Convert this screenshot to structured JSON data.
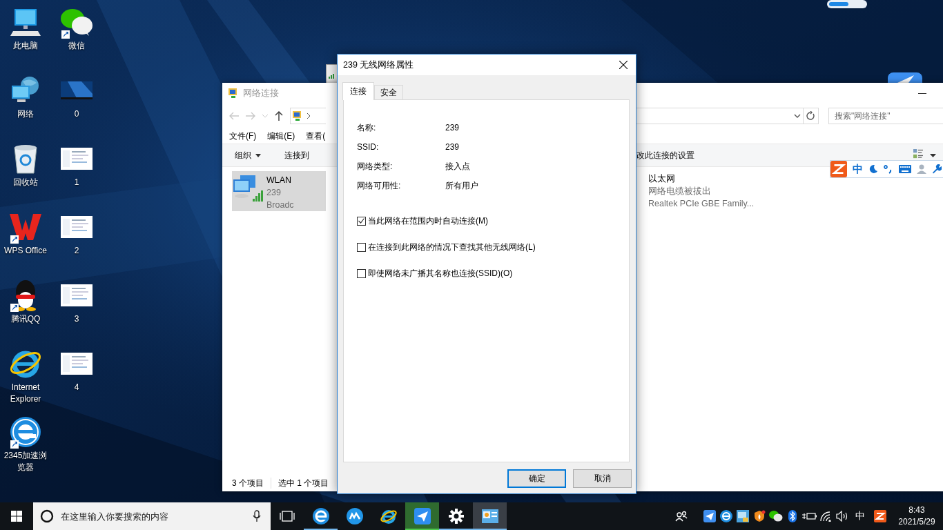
{
  "desktop": {
    "icons": [
      {
        "label": "此电脑",
        "kind": "computer",
        "shortcut": false
      },
      {
        "label": "微信",
        "kind": "wechat",
        "shortcut": true
      },
      {
        "label": "网络",
        "kind": "network",
        "shortcut": false
      },
      {
        "label": "0",
        "kind": "wallpaper-thumb",
        "shortcut": false
      },
      {
        "label": "回收站",
        "kind": "recycle-bin",
        "shortcut": false
      },
      {
        "label": "1",
        "kind": "page-thumb",
        "shortcut": false
      },
      {
        "label": "WPS Office",
        "kind": "wps",
        "shortcut": true
      },
      {
        "label": "2",
        "kind": "page-thumb",
        "shortcut": false
      },
      {
        "label": "腾讯QQ",
        "kind": "penguin",
        "shortcut": true
      },
      {
        "label": "3",
        "kind": "page-thumb",
        "shortcut": false
      },
      {
        "label": "Internet Explorer",
        "kind": "ie",
        "shortcut": false
      },
      {
        "label": "4",
        "kind": "page-thumb",
        "shortcut": false
      },
      {
        "label": "2345加速浏览器",
        "kind": "browser",
        "shortcut": true
      }
    ]
  },
  "explorer": {
    "title": "网络连接",
    "menu": [
      "文件(F)",
      "编辑(E)",
      "查看("
    ],
    "commands": [
      {
        "label": "组织",
        "dropdown": true
      },
      {
        "label": "连接到",
        "dropdown": false
      }
    ],
    "command_right": "改此连接的设置",
    "search": {
      "placeholder": "搜索\"网络连接\""
    },
    "items": [
      {
        "name": "WLAN",
        "details": [
          "239",
          "Broadc"
        ],
        "selected": true
      },
      {
        "name": "以太网",
        "details": [
          "网络电缆被拔出",
          "Realtek PCIe GBE Family..."
        ],
        "selected": false
      }
    ],
    "status": [
      "3 个项目",
      "选中 1 个项目"
    ]
  },
  "dialog": {
    "title": "239 无线网络属性",
    "tabs": [
      {
        "label": "连接",
        "selected": true
      },
      {
        "label": "安全",
        "selected": false
      }
    ],
    "fields": [
      {
        "label": "名称:",
        "value": "239"
      },
      {
        "label": "SSID:",
        "value": "239"
      },
      {
        "label": "网络类型:",
        "value": "接入点"
      },
      {
        "label": "网络可用性:",
        "value": "所有用户"
      }
    ],
    "options": [
      {
        "label": "当此网络在范围内时自动连接(M)",
        "checked": true
      },
      {
        "label": "在连接到此网络的情况下查找其他无线网络(L)",
        "checked": false
      },
      {
        "label": "即使网络未广播其名称也连接(SSID)(O)",
        "checked": false
      }
    ],
    "buttons": [
      {
        "label": "确定",
        "default": true
      },
      {
        "label": "取消",
        "default": false
      }
    ]
  },
  "ime_bar": {
    "language": "中"
  },
  "taskbar": {
    "search": {
      "placeholder": "在这里输入你要搜索的内容"
    },
    "apps": [
      {
        "kind": "browser",
        "running": true,
        "selected": false,
        "attention": false
      },
      {
        "kind": "cloud",
        "running": false,
        "selected": false,
        "attention": false
      },
      {
        "kind": "ie",
        "running": false,
        "selected": false,
        "attention": false
      },
      {
        "kind": "plane",
        "running": true,
        "selected": false,
        "attention": true
      },
      {
        "kind": "gear",
        "running": true,
        "selected": false,
        "attention": false
      },
      {
        "kind": "control-panel",
        "running": true,
        "selected": true,
        "attention": false
      }
    ],
    "tray": [
      {
        "kind": "people"
      },
      {
        "kind": "plane"
      },
      {
        "kind": "browser"
      },
      {
        "kind": "network-app"
      },
      {
        "kind": "shield"
      },
      {
        "kind": "wechat"
      },
      {
        "kind": "bluetooth"
      },
      {
        "kind": "battery"
      },
      {
        "kind": "wifi"
      },
      {
        "kind": "volume"
      },
      {
        "kind": "text",
        "label": "中"
      },
      {
        "kind": "z-app"
      }
    ],
    "time": "8:43",
    "date": "2021/5/29"
  }
}
